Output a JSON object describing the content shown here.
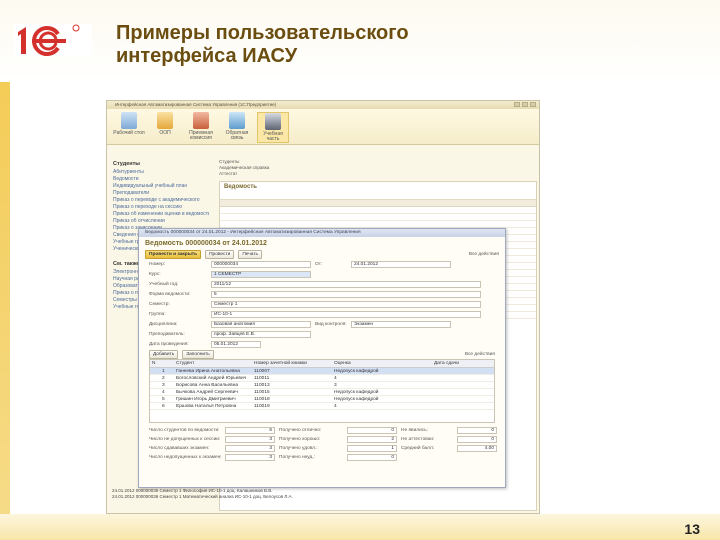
{
  "slide": {
    "title_line1": "Примеры пользовательского",
    "title_line2": "интерфейса ИАСУ",
    "page_number": "13"
  },
  "app": {
    "window_title": "Интерфейсная Автоматизированная Система Управления (1С:Предприятие)",
    "sections": [
      {
        "label": "Рабочий стол",
        "icon": "desktop-icon"
      },
      {
        "label": "ООП",
        "icon": "letter-a-icon"
      },
      {
        "label": "Приемная комиссия",
        "icon": "building-icon"
      },
      {
        "label": "Обратная связь",
        "icon": "sync-icon"
      },
      {
        "label": "Учебная часть",
        "icon": "graduate-cap-icon"
      }
    ],
    "sidebar_title": "Студенты",
    "sidebar_items": [
      "Абитуриенты",
      "Ведомости",
      "Индивидуальный учебный план",
      "Преподаватели",
      "Приказ о переводе с академического",
      "Приказ о переходе на сессию",
      "Приказ об изменении оценки в ведомости",
      "Приказ об отчислении",
      "Приказ о зачислении",
      "Сведения о смене группы",
      "Учебные группы",
      "Ученические поля"
    ],
    "sidebar_title2": "См. также",
    "sidebar_items2": [
      "Электронные отчеты",
      "Научная работа студентов",
      "Образовательные программы",
      "Приказ о практике",
      "Семестры",
      "Учебные годы"
    ],
    "subnav": [
      "Студенты",
      "Академическая справка",
      "Аттестат"
    ],
    "list_title": "Ведомость"
  },
  "document": {
    "window_title": "Ведомость 000000034 от 24.01.2012 - Интерфейсная Автоматизированная Система Управления",
    "heading": "Ведомость 000000034 от 24.01.2012",
    "buttons": {
      "post_close": "Провести и закрыть",
      "post": "Провести",
      "print": "Печать",
      "more": "Все действия"
    },
    "fields": [
      {
        "label": "Номер:",
        "value": "000000034",
        "label2": "От:",
        "value2": "24.01.2012"
      },
      {
        "label": "Курс:",
        "value": "1 СЕМЕСТР"
      },
      {
        "label": "Учебный год:",
        "value": "2011/12"
      },
      {
        "label": "Форма ведомости:",
        "value": "5"
      },
      {
        "label": "Семестр:",
        "value": "Семестр 1"
      },
      {
        "label": "Группа:",
        "value": "ИС-10-1"
      },
      {
        "label": "Дисциплина:",
        "value": "Базовая анатомия",
        "label2": "Вид контроля:",
        "value2": "Экзамен"
      },
      {
        "label": "Преподаватель:",
        "value": "проф. Зайцев Е.В."
      },
      {
        "label": "Дата проведения:",
        "value": "05.01.2012"
      }
    ],
    "grid_toolbar": {
      "add": "Добавить",
      "fill": "Заполнить",
      "more": "Все действия"
    },
    "grid_headers": [
      "N",
      "Студент",
      "Номер зачетной книжки",
      "Оценка",
      "Дата сдачи"
    ],
    "grid_rows": [
      {
        "n": "1",
        "student": "Ганеева Ирина Анатольевна",
        "book": "110007",
        "grade": "Недопуск кафедрой",
        "date": ""
      },
      {
        "n": "2",
        "student": "Богословский Андрей Юрьевич",
        "book": "110011",
        "grade": "4",
        "date": ""
      },
      {
        "n": "3",
        "student": "Борисова Анна Васильевна",
        "book": "110013",
        "grade": "3",
        "date": ""
      },
      {
        "n": "4",
        "student": "Бычкова Андрей Сергеевич",
        "book": "110015",
        "grade": "Недопуск кафедрой",
        "date": ""
      },
      {
        "n": "5",
        "student": "Гришин Игорь Дмитриевич",
        "book": "110018",
        "grade": "Недопуск кафедрой",
        "date": ""
      },
      {
        "n": "6",
        "student": "Ершова Наталья Петровна",
        "book": "110019",
        "grade": "4",
        "date": ""
      }
    ],
    "totals": [
      {
        "label": "Число студентов по ведомости:",
        "value": "6",
        "label2": "Получено отлично:",
        "value2": "0",
        "label3": "Не явились:",
        "value3": "0"
      },
      {
        "label": "Число не допущенных к сессии:",
        "value": "3",
        "label2": "Получено хорошо:",
        "value2": "2",
        "label3": "Не аттестован:",
        "value3": "0"
      },
      {
        "label": "Число сдававших экзамен:",
        "value": "3",
        "label2": "Получено удовл.:",
        "value2": "1",
        "label3": "Средний балл:",
        "value3": "4.00"
      },
      {
        "label": "Число недопущенных к экзамену:",
        "value": "3",
        "label2": "Получено неуд.:",
        "value2": "0",
        "label3": "",
        "value3": ""
      }
    ]
  },
  "bottom_rows": [
    "24.01.2012   000000035   Семестр 1   Философия   ИС-10-1   доц. Калашников В.В.",
    "24.01.2012   000000036   Семестр 1   Математический анализ   ИС-10-1   доц. Белоусов Л.А."
  ]
}
